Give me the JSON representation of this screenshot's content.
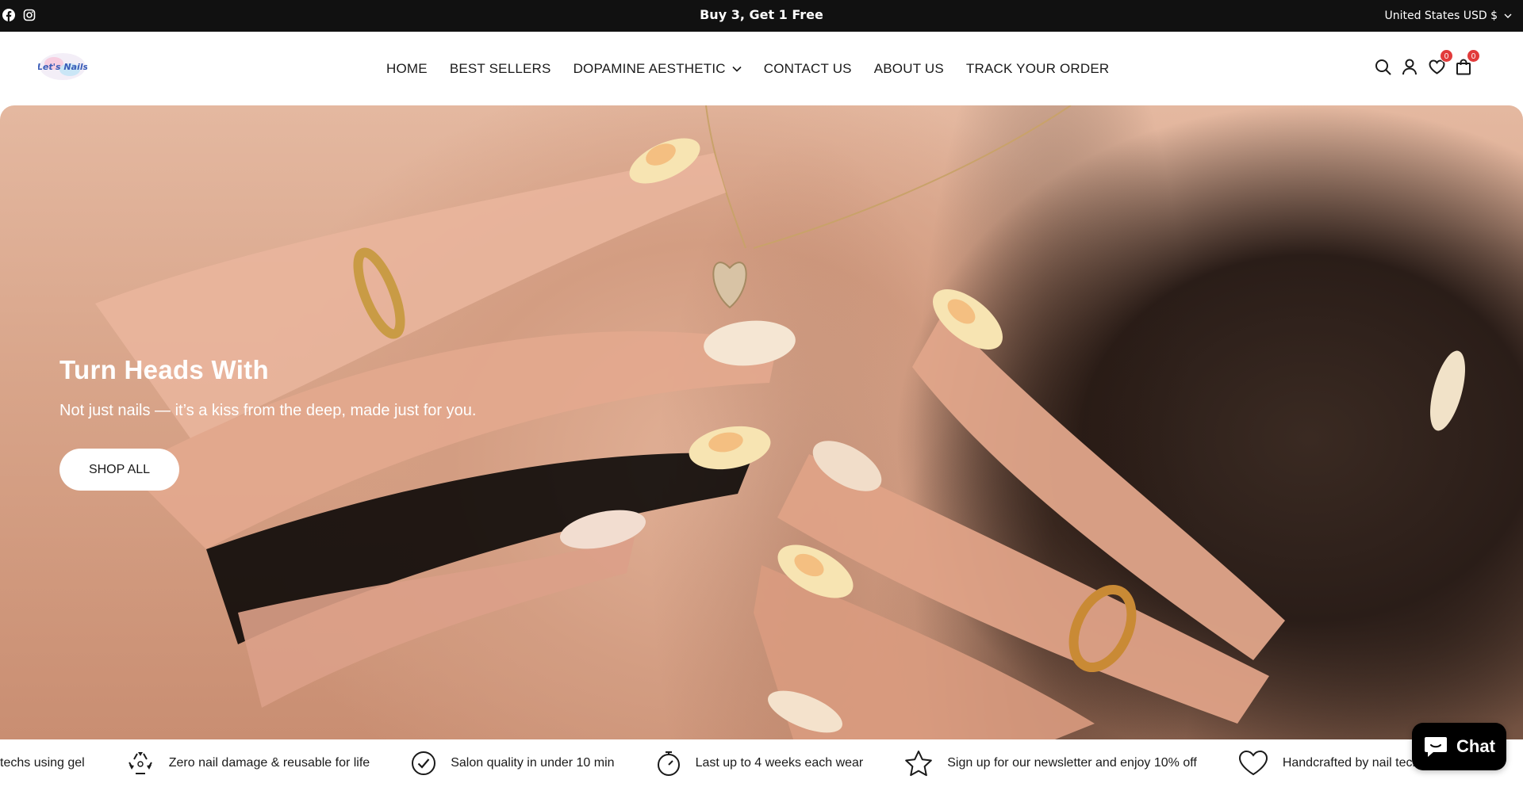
{
  "announcement": {
    "promo_text": "Buy 3, Get 1 Free",
    "currency_label": "United States USD $",
    "social_icons": [
      "facebook-icon",
      "instagram-icon"
    ]
  },
  "header": {
    "logo_text": "LET'S NAILS",
    "nav": [
      {
        "label": "HOME"
      },
      {
        "label": "BEST SELLERS"
      },
      {
        "label": "DOPAMINE AESTHETIC",
        "has_dropdown": true
      },
      {
        "label": "CONTACT US"
      },
      {
        "label": "ABOUT US"
      },
      {
        "label": "TRACK YOUR ORDER"
      }
    ],
    "icons": [
      "search-icon",
      "account-icon",
      "wishlist-icon",
      "cart-icon"
    ],
    "wishlist_count": "0",
    "cart_count": "0"
  },
  "hero": {
    "heading": "Turn Heads With",
    "subheading": "Not just nails — it’s a kiss from the deep, made just for you.",
    "cta_label": "SHOP ALL"
  },
  "marquee": {
    "items": [
      {
        "icon": "none",
        "text": "techs using gel"
      },
      {
        "icon": "recycle-icon",
        "text": "Zero nail damage & reusable for life"
      },
      {
        "icon": "check-circle-icon",
        "text": "Salon quality in under 10 min"
      },
      {
        "icon": "timer-icon",
        "text": "Last up to 4 weeks each wear"
      },
      {
        "icon": "star-icon",
        "text": "Sign up for our newsletter and enjoy 10% off"
      },
      {
        "icon": "heart-icon",
        "text": "Handcrafted by nail techs using gel"
      }
    ]
  },
  "chat": {
    "label": "Chat"
  },
  "colors": {
    "announcement_bg": "#111111",
    "badge": "#e23b3b",
    "chat_bg": "#000000"
  }
}
